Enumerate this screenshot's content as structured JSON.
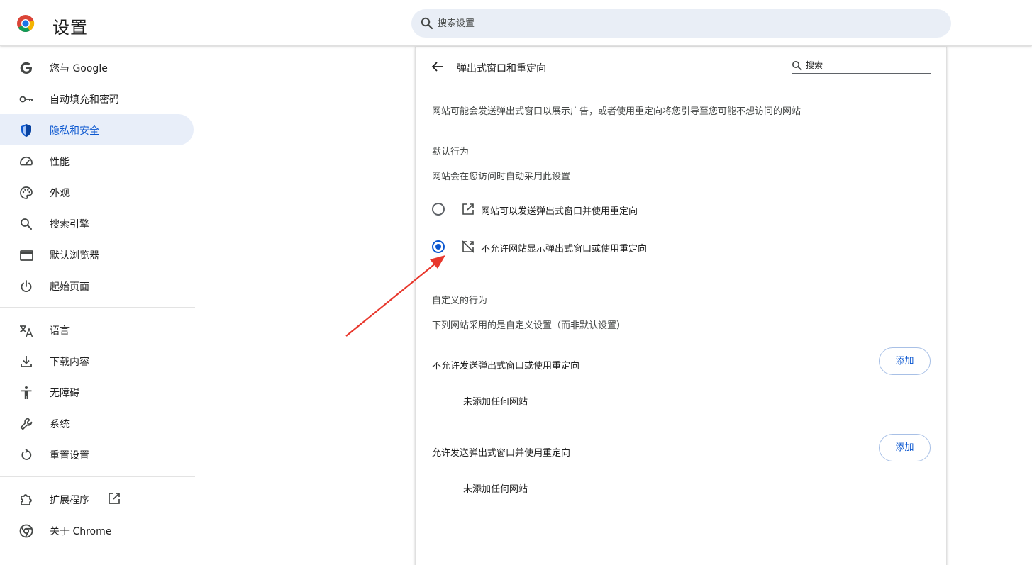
{
  "header": {
    "title": "设置",
    "search_placeholder": "搜索设置"
  },
  "sidebar": {
    "items": [
      {
        "label": "您与 Google",
        "icon": "google-g-icon"
      },
      {
        "label": "自动填充和密码",
        "icon": "key-icon"
      },
      {
        "label": "隐私和安全",
        "icon": "shield-icon",
        "active": true
      },
      {
        "label": "性能",
        "icon": "speedometer-icon"
      },
      {
        "label": "外观",
        "icon": "palette-icon"
      },
      {
        "label": "搜索引擎",
        "icon": "search-icon"
      },
      {
        "label": "默认浏览器",
        "icon": "browser-window-icon"
      },
      {
        "label": "起始页面",
        "icon": "power-icon"
      },
      {
        "label": "语言",
        "icon": "translate-icon"
      },
      {
        "label": "下载内容",
        "icon": "download-icon"
      },
      {
        "label": "无障碍",
        "icon": "accessibility-icon"
      },
      {
        "label": "系统",
        "icon": "wrench-icon"
      },
      {
        "label": "重置设置",
        "icon": "reset-icon"
      },
      {
        "label": "扩展程序",
        "icon": "puzzle-icon"
      },
      {
        "label": "关于 Chrome",
        "icon": "chrome-icon"
      }
    ]
  },
  "main": {
    "page_title": "弹出式窗口和重定向",
    "search_placeholder": "搜索",
    "description": "网站可能会发送弹出式窗口以展示广告，或者使用重定向将您引导至您可能不想访问的网站",
    "default_behavior": {
      "heading": "默认行为",
      "subheading": "网站会在您访问时自动采用此设置",
      "options": [
        {
          "label": "网站可以发送弹出式窗口并使用重定向",
          "checked": false
        },
        {
          "label": "不允许网站显示弹出式窗口或使用重定向",
          "checked": true
        }
      ]
    },
    "custom_behavior": {
      "heading": "自定义的行为",
      "subheading": "下列网站采用的是自定义设置（而非默认设置）",
      "sections": [
        {
          "title": "不允许发送弹出式窗口或使用重定向",
          "add_label": "添加",
          "empty_text": "未添加任何网站"
        },
        {
          "title": "允许发送弹出式窗口并使用重定向",
          "add_label": "添加",
          "empty_text": "未添加任何网站"
        }
      ]
    }
  },
  "colors": {
    "accent": "#0b57d0",
    "active_nav_bg": "#e8eef9",
    "search_bg": "#e9eef6",
    "annotation_arrow": "#e8372c"
  }
}
